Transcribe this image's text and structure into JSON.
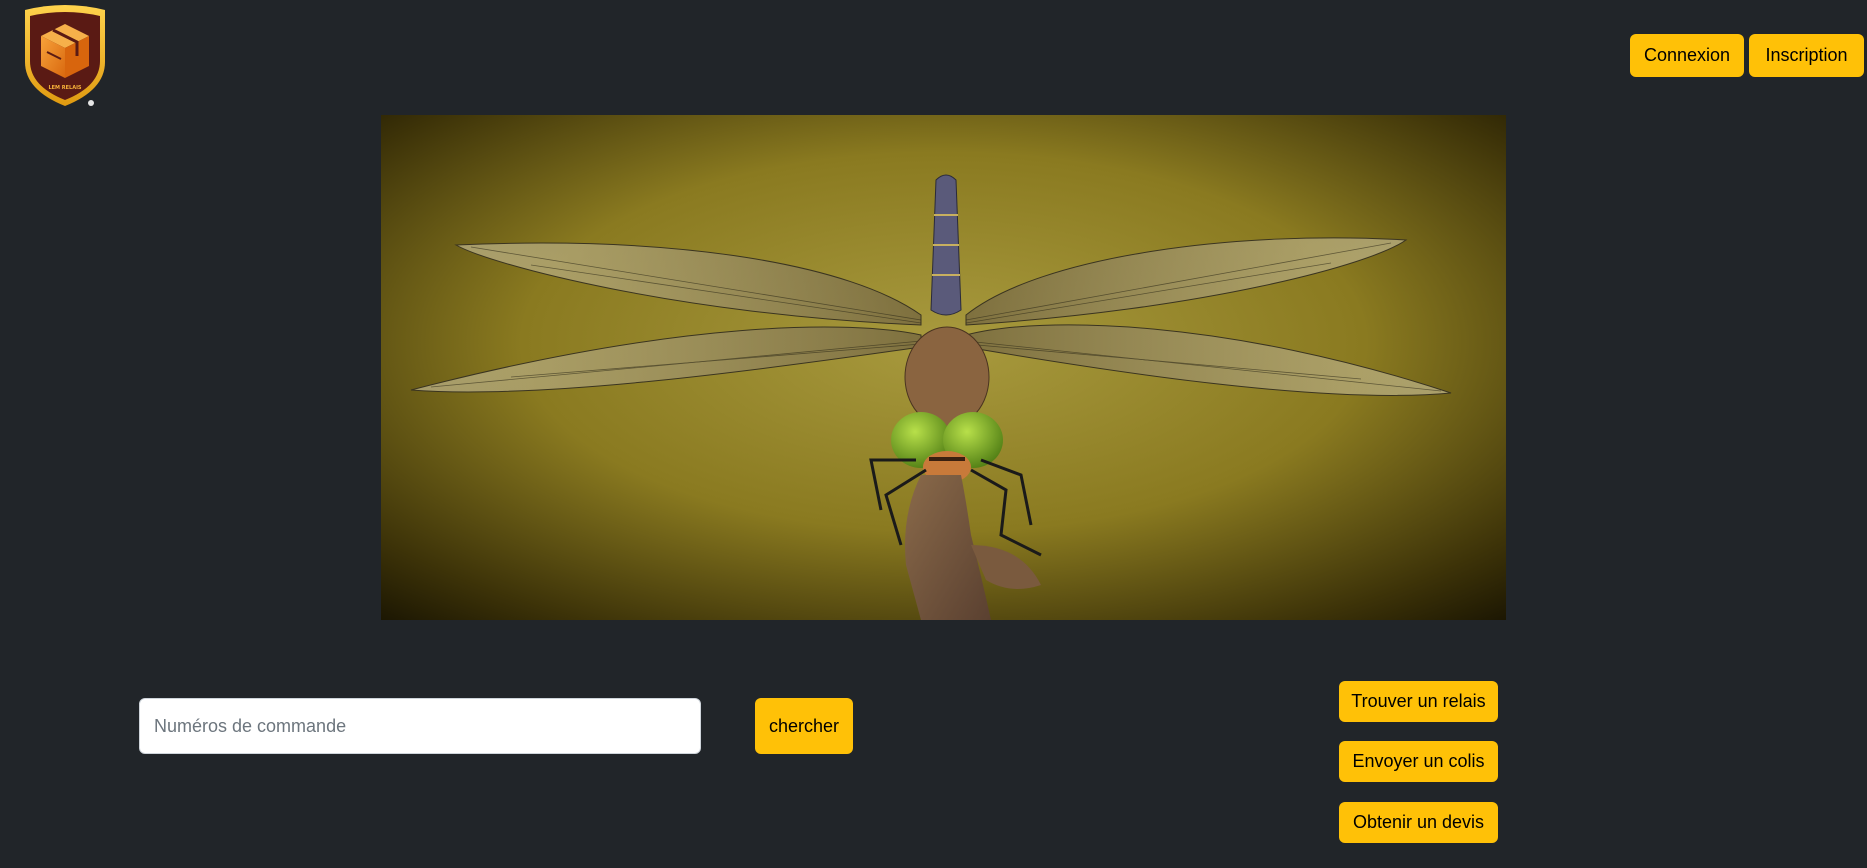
{
  "header": {
    "logo_text": "LEM RELAIS",
    "login_label": "Connexion",
    "signup_label": "Inscription"
  },
  "hero": {
    "image_subject": "dragonfly-photo"
  },
  "search": {
    "placeholder": "Numéros de commande",
    "value": "",
    "button_label": "chercher"
  },
  "actions": {
    "find_relay_label": "Trouver un relais",
    "send_parcel_label": "Envoyer un colis",
    "get_quote_label": "Obtenir un devis"
  },
  "colors": {
    "background": "#212529",
    "accent": "#ffc107",
    "logo_dark": "#5a1a14",
    "logo_orange": "#e8801a"
  }
}
